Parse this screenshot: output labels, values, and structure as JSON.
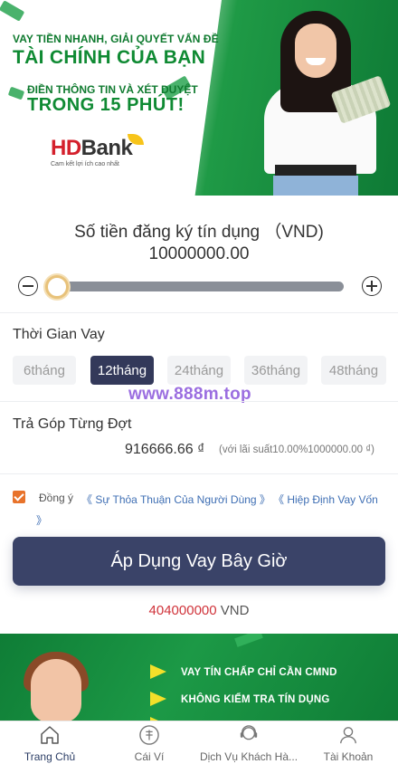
{
  "hero": {
    "line1": "VAY TIỀN NHANH, GIẢI QUYẾT VẤN ĐỀ",
    "line2": "TÀI CHÍNH CỦA BẠN",
    "line3": "ĐIỀN THÔNG TIN VÀ XÉT DUYỆT",
    "line4": "TRONG 15 PHÚT!",
    "brand_red": "HD",
    "brand_dark": "Bank",
    "brand_tagline": "Cam kết lợi ích cao nhất"
  },
  "amount": {
    "title": "Số tiền đăng ký tín dụng （VND)",
    "value": "10000000.00",
    "slider_fraction": 0.0
  },
  "term": {
    "label": "Thời Gian Vay",
    "options": [
      "6tháng",
      "12tháng",
      "24tháng",
      "36tháng",
      "48tháng"
    ],
    "selected_index": 1
  },
  "watermark": "www.888m.top",
  "installment": {
    "label": "Trả Góp Từng Đợt",
    "value": "916666.66 ₫",
    "note": "(với lãi suất10.00%1000000.00 ₫)"
  },
  "agreement": {
    "checked": true,
    "text": "Đồng ý",
    "link1": "《 Sự Thỏa Thuận Của Người Dùng 》",
    "link2a": "《 Hiệp Định Vay Vốn",
    "link2b": "》"
  },
  "apply_button": "Áp Dụng Vay Bây Giờ",
  "ticker": {
    "number": "404000000",
    "unit": " VND"
  },
  "promo": {
    "line1": "VAY TÍN CHẤP CHỈ CẦN CMND",
    "line2": "KHÔNG KIỂM TRA TÍN DỤNG"
  },
  "tabbar": {
    "items": [
      {
        "label": "Trang Chủ",
        "icon": "home-icon"
      },
      {
        "label": "Cái Ví",
        "icon": "wallet-icon"
      },
      {
        "label": "Dịch Vụ Khách Hà...",
        "icon": "customer-service-icon"
      },
      {
        "label": "Tài Khoản",
        "icon": "user-icon"
      }
    ],
    "active_index": 0
  },
  "colors": {
    "primary": "#3a4368",
    "green": "#1c9946",
    "accent_orange": "#e8732b",
    "link": "#3f6fb4",
    "ticker_red": "#d0343b",
    "watermark": "#9b6ee0"
  }
}
